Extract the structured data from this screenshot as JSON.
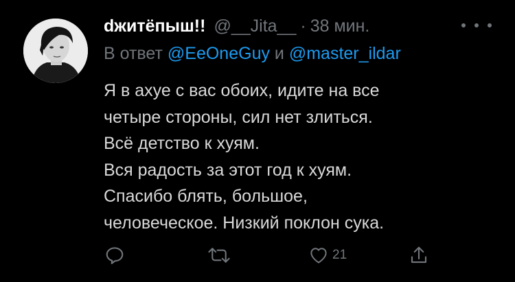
{
  "tweet": {
    "author_name": "ԁжитёпыш!!",
    "author_handle": "@__Jita__",
    "separator": "·",
    "timestamp": "38 мин.",
    "reply_prefix": "В ответ",
    "reply_to_1": "@EeOneGuy",
    "reply_conjunction": "и",
    "reply_to_2": "@master_ildar",
    "body_lines": [
      "Я в ахуе с вас обоих, идите на все",
      "четыре стороны, сил нет злиться.",
      "Всё детство к хуям.",
      "Вся радость за этот год к хуям.",
      "Спасибо блять, большое,",
      "человеческое. Низкий поклон сука."
    ]
  },
  "actions": {
    "reply_icon": "reply-icon",
    "retweet_icon": "retweet-icon",
    "like_icon": "like-icon",
    "like_count": "21",
    "share_icon": "share-icon"
  },
  "colors": {
    "background": "#000000",
    "text": "#d9d9d9",
    "muted": "#71767b",
    "accent": "#1d9bf0"
  }
}
